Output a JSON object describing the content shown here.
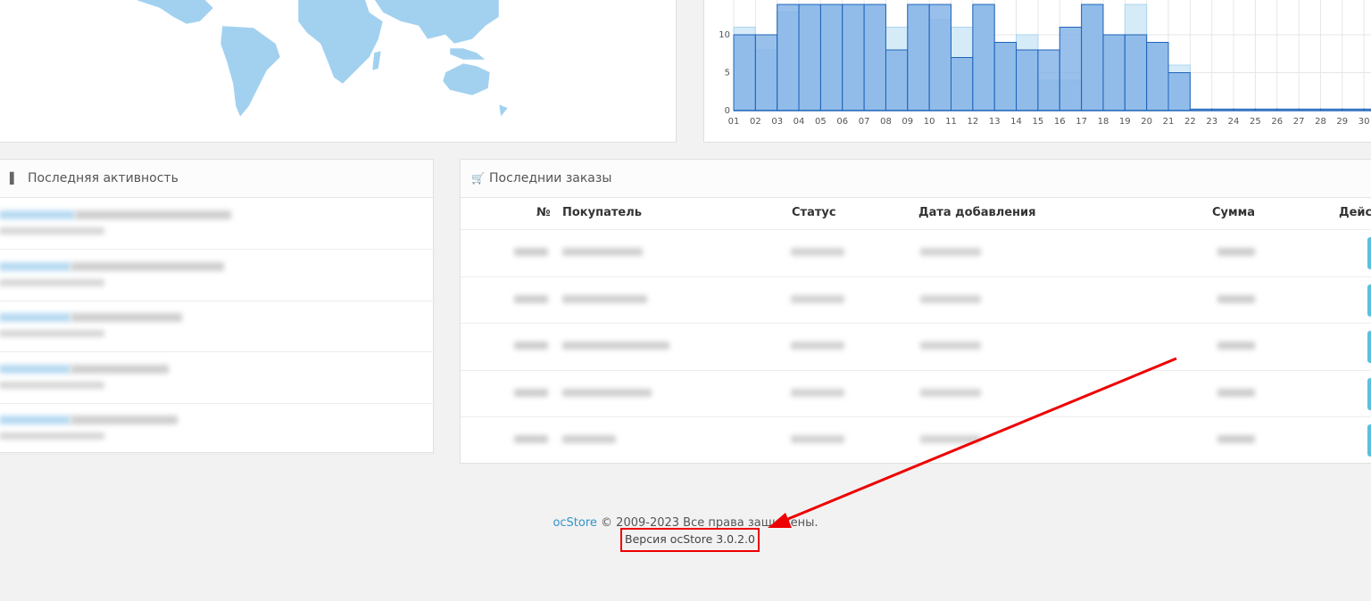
{
  "activity": {
    "title": "Последняя активность",
    "item_count": 5
  },
  "orders": {
    "title": "Последнии заказы",
    "columns": [
      "№",
      "Покупатель",
      "Статус",
      "Дата добавления",
      "Сумма",
      "Дейст"
    ],
    "row_count": 5
  },
  "footer": {
    "brand": "ocStore",
    "copyright": "© 2009-2023 Все права защищены.",
    "version": "Версия ocStore 3.0.2.0"
  },
  "chart_data": {
    "type": "bar",
    "categories": [
      "01",
      "02",
      "03",
      "04",
      "05",
      "06",
      "07",
      "08",
      "09",
      "10",
      "11",
      "12",
      "13",
      "14",
      "15",
      "16",
      "17",
      "18",
      "19",
      "20",
      "21",
      "22",
      "23",
      "24",
      "25",
      "26",
      "27",
      "28",
      "29",
      "30"
    ],
    "series": [
      {
        "values": [
          10,
          10,
          14,
          14,
          14,
          14,
          14,
          8,
          14,
          14,
          7,
          14,
          9,
          8,
          8,
          11,
          14,
          10,
          10,
          9,
          5,
          0.2,
          0.2,
          0.2,
          0.2,
          0.2,
          0.2,
          0.2,
          0.2,
          0.2
        ]
      },
      {
        "values": [
          11,
          8,
          13,
          14,
          14,
          14,
          14,
          11,
          14,
          12,
          11,
          14,
          9,
          10,
          4,
          4,
          14,
          10,
          14,
          9,
          6,
          0,
          0,
          0,
          0,
          0,
          0,
          0,
          0,
          0
        ]
      }
    ],
    "yticks": [
      0,
      5,
      10
    ],
    "ylim": [
      0,
      14
    ],
    "grid": true,
    "colors": {
      "primary": "#7fb0e6",
      "primary_border": "#1e63b8",
      "secondary": "#cfe7f7"
    }
  },
  "colors": {
    "accent": "#3494c8",
    "btn_info": "#5bc0de",
    "annotation": "#e00000"
  }
}
